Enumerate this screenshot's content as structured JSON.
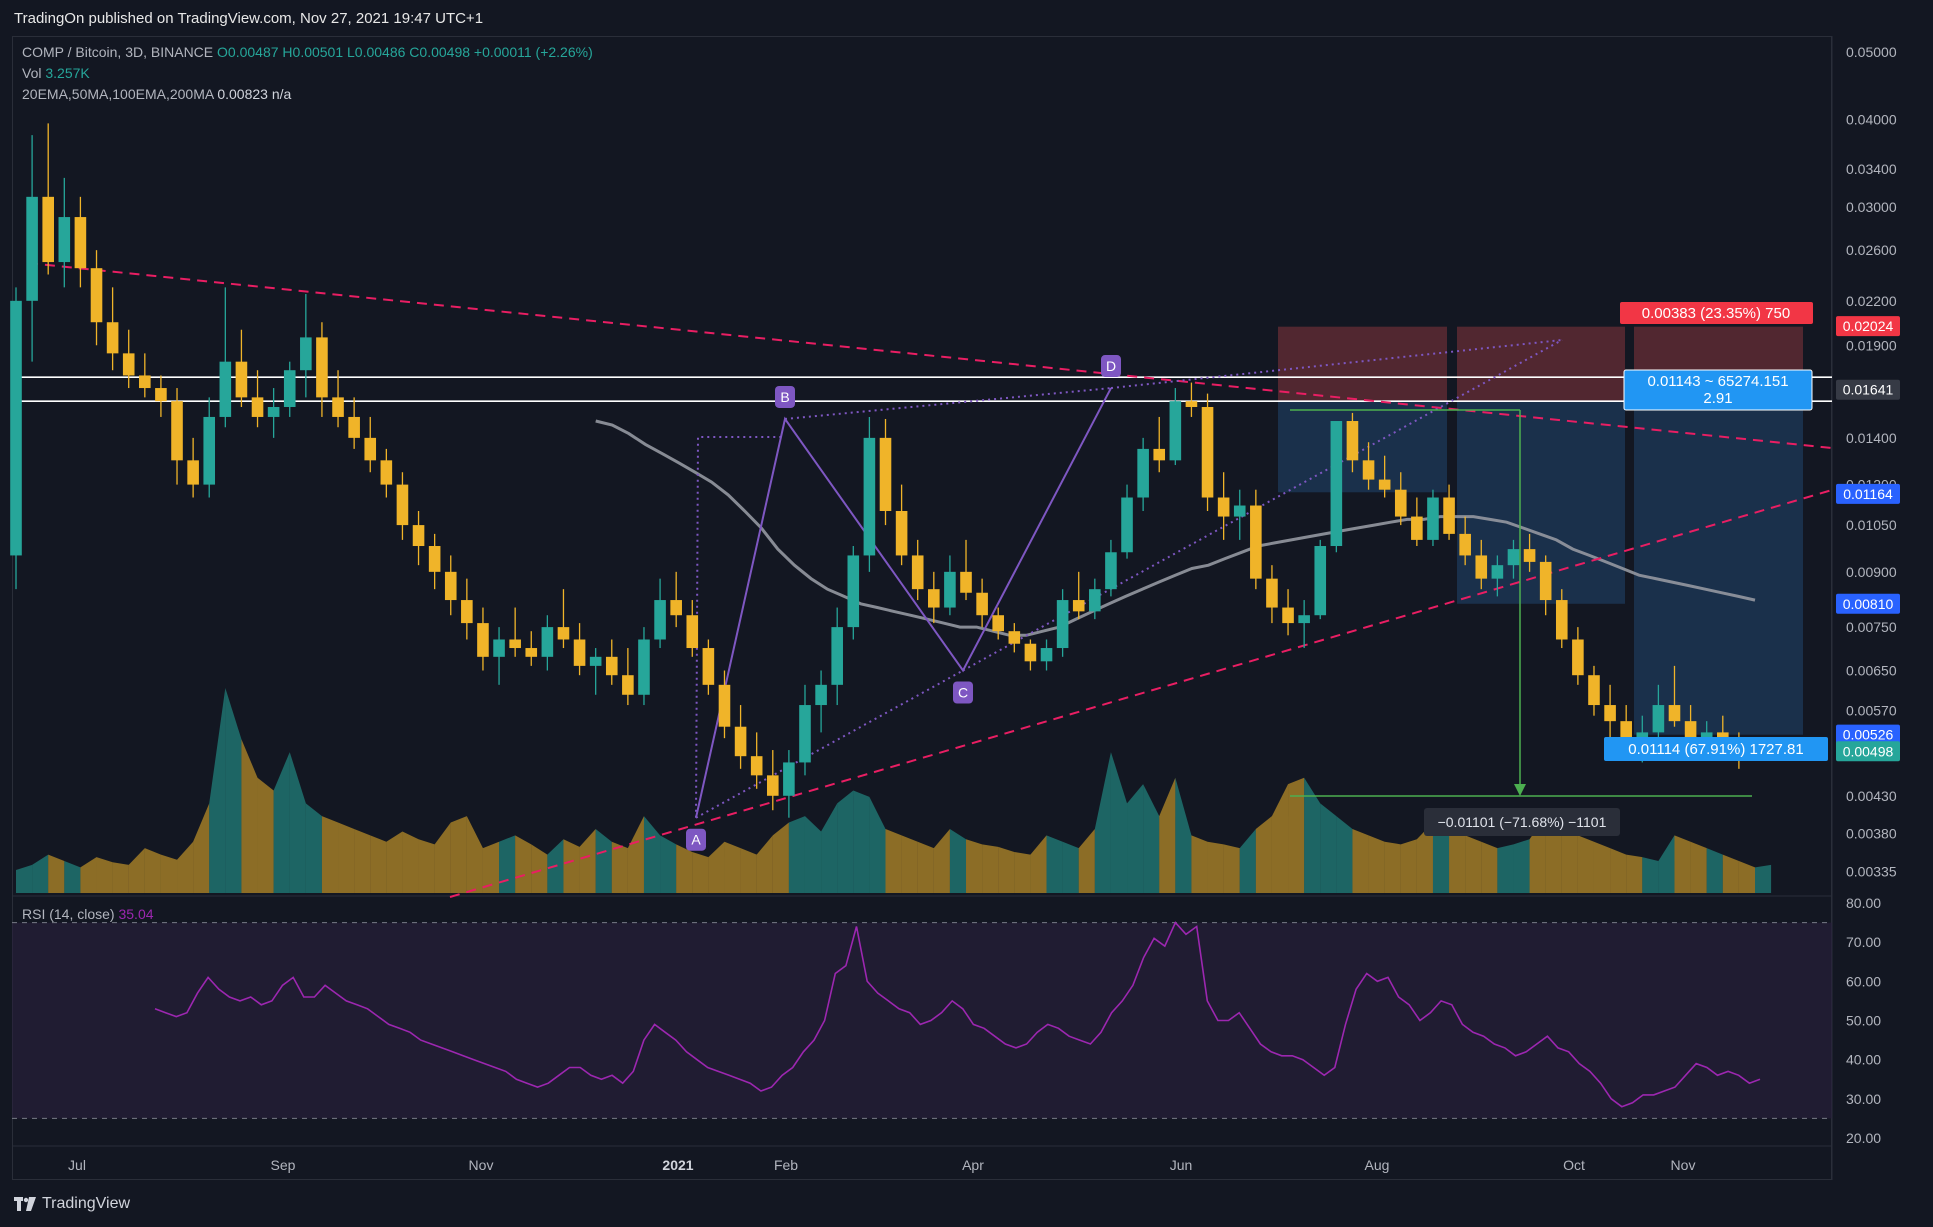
{
  "publisher": "TradingOn published on TradingView.com, Nov 27, 2021 19:47 UTC+1",
  "footer_brand": "TradingView",
  "legend": {
    "symbol": "COMP / Bitcoin, 3D, BINANCE",
    "ohlc": "O0.00487 H0.00501 L0.00486 C0.00498 +0.00011 (+2.26%)",
    "vol_label": "Vol",
    "vol_value": "3.257K",
    "ma_label": "20EMA,50MA,100EMA,200MA",
    "ma_value": "0.00823  n/a",
    "rsi_label": "RSI (14, close)",
    "rsi_value": "35.04"
  },
  "colors": {
    "bg": "#131722",
    "up": "#26a69a",
    "down": "#f0b429",
    "trend": "#e91e63",
    "harmonic": "#7e57c2",
    "rsi": "#9c27b0",
    "ma": "#9598a1",
    "stop_zone": "#5d2a32",
    "target_zone": "#1e3a5a"
  },
  "chart_data": [
    {
      "type": "candlestick",
      "title": "",
      "yscale": "log",
      "ylim": [
        0.0031,
        0.052
      ],
      "y_ticks": [
        "0.05000",
        "0.04000",
        "0.03400",
        "0.03000",
        "0.02600",
        "0.02200",
        "0.01900",
        "0.01400",
        "0.01200",
        "0.01050",
        "0.00900",
        "0.00750",
        "0.00650",
        "0.00570",
        "0.00430",
        "0.00380",
        "0.00335"
      ],
      "x_ticks": [
        "Jul",
        "Sep",
        "Nov",
        "2021",
        "Feb",
        "Apr",
        "Jun",
        "Aug",
        "Oct",
        "Nov"
      ],
      "price_badges": [
        {
          "label": "0.02024",
          "value": 0.02024,
          "color": "#f23645"
        },
        {
          "label": "0.01641",
          "value": 0.01641,
          "color": "#363a45"
        },
        {
          "label": "0.01164",
          "value": 0.01164,
          "color": "#2962ff"
        },
        {
          "label": "0.00810",
          "value": 0.0081,
          "color": "#2962ff"
        },
        {
          "label": "0.00526",
          "value": 0.00526,
          "color": "#2962ff"
        },
        {
          "label": "0.00498",
          "value": 0.00498,
          "color": "#26a69a"
        }
      ],
      "horizontal_levels": [
        0.0171,
        0.0158
      ],
      "harmonic_points": [
        {
          "label": "A",
          "date": "2020-12-29",
          "value": 0.004
        },
        {
          "label": "B",
          "date": "2021-01-31",
          "value": 0.0149
        },
        {
          "label": "C",
          "date": "2021-03-29",
          "value": 0.0065
        },
        {
          "label": "D",
          "date": "2021-05-19",
          "value": 0.0165
        }
      ],
      "position_boxes": [
        {
          "stop_label": "0.00383 (23.35%) 750",
          "target_label": "0.01143 ~ 65274.151",
          "ratio": "2.91"
        }
      ],
      "measure_label": "−0.01101 (−71.68%) −1101",
      "last_label": "0.01114 (67.91%) 1727.81",
      "candles": [
        [
          0.0095,
          0.023,
          0.0085,
          0.022
        ],
        [
          0.022,
          0.038,
          0.018,
          0.031
        ],
        [
          0.031,
          0.0395,
          0.024,
          0.025
        ],
        [
          0.025,
          0.033,
          0.023,
          0.029
        ],
        [
          0.029,
          0.031,
          0.023,
          0.0245
        ],
        [
          0.0245,
          0.026,
          0.019,
          0.0205
        ],
        [
          0.0205,
          0.023,
          0.0175,
          0.0185
        ],
        [
          0.0185,
          0.02,
          0.0165,
          0.0172
        ],
        [
          0.0172,
          0.0185,
          0.016,
          0.0165
        ],
        [
          0.0165,
          0.0172,
          0.015,
          0.0158
        ],
        [
          0.0158,
          0.0165,
          0.012,
          0.013
        ],
        [
          0.013,
          0.014,
          0.0115,
          0.012
        ],
        [
          0.012,
          0.016,
          0.0115,
          0.015
        ],
        [
          0.015,
          0.023,
          0.0145,
          0.018
        ],
        [
          0.018,
          0.02,
          0.0155,
          0.016
        ],
        [
          0.016,
          0.0175,
          0.0145,
          0.015
        ],
        [
          0.015,
          0.0165,
          0.014,
          0.0155
        ],
        [
          0.0155,
          0.018,
          0.015,
          0.0175
        ],
        [
          0.0175,
          0.0225,
          0.016,
          0.0195
        ],
        [
          0.0195,
          0.0205,
          0.015,
          0.016
        ],
        [
          0.016,
          0.0175,
          0.0145,
          0.015
        ],
        [
          0.015,
          0.016,
          0.0135,
          0.014
        ],
        [
          0.014,
          0.015,
          0.0125,
          0.013
        ],
        [
          0.013,
          0.0135,
          0.0115,
          0.012
        ],
        [
          0.012,
          0.0125,
          0.01,
          0.0105
        ],
        [
          0.0105,
          0.011,
          0.0092,
          0.0098
        ],
        [
          0.0098,
          0.0102,
          0.0085,
          0.009
        ],
        [
          0.009,
          0.0095,
          0.0078,
          0.0082
        ],
        [
          0.0082,
          0.0088,
          0.0072,
          0.0076
        ],
        [
          0.0076,
          0.008,
          0.0065,
          0.0068
        ],
        [
          0.0068,
          0.0075,
          0.0062,
          0.0072
        ],
        [
          0.0072,
          0.008,
          0.0068,
          0.007
        ],
        [
          0.007,
          0.0074,
          0.0066,
          0.0068
        ],
        [
          0.0068,
          0.0078,
          0.0065,
          0.0075
        ],
        [
          0.0075,
          0.0085,
          0.007,
          0.0072
        ],
        [
          0.0072,
          0.0076,
          0.0064,
          0.0066
        ],
        [
          0.0066,
          0.007,
          0.006,
          0.0068
        ],
        [
          0.0068,
          0.0072,
          0.0062,
          0.0064
        ],
        [
          0.0064,
          0.007,
          0.0058,
          0.006
        ],
        [
          0.006,
          0.0075,
          0.0058,
          0.0072
        ],
        [
          0.0072,
          0.0088,
          0.007,
          0.0082
        ],
        [
          0.0082,
          0.009,
          0.0075,
          0.0078
        ],
        [
          0.0078,
          0.0082,
          0.0068,
          0.007
        ],
        [
          0.007,
          0.0072,
          0.006,
          0.0062
        ],
        [
          0.0062,
          0.0065,
          0.0052,
          0.0054
        ],
        [
          0.0054,
          0.0058,
          0.0047,
          0.0049
        ],
        [
          0.0049,
          0.0053,
          0.0044,
          0.0046
        ],
        [
          0.0046,
          0.005,
          0.0041,
          0.0043
        ],
        [
          0.0043,
          0.005,
          0.004,
          0.0048
        ],
        [
          0.0048,
          0.0062,
          0.0046,
          0.0058
        ],
        [
          0.0058,
          0.0065,
          0.0053,
          0.0062
        ],
        [
          0.0062,
          0.008,
          0.0058,
          0.0075
        ],
        [
          0.0075,
          0.0098,
          0.0072,
          0.0095
        ],
        [
          0.0095,
          0.015,
          0.009,
          0.014
        ],
        [
          0.014,
          0.0149,
          0.0105,
          0.011
        ],
        [
          0.011,
          0.012,
          0.0092,
          0.0095
        ],
        [
          0.0095,
          0.01,
          0.0082,
          0.0085
        ],
        [
          0.0085,
          0.009,
          0.0076,
          0.008
        ],
        [
          0.008,
          0.0095,
          0.0078,
          0.009
        ],
        [
          0.009,
          0.01,
          0.0082,
          0.0084
        ],
        [
          0.0084,
          0.0088,
          0.0075,
          0.0078
        ],
        [
          0.0078,
          0.008,
          0.0072,
          0.0074
        ],
        [
          0.0074,
          0.0076,
          0.0069,
          0.0071
        ],
        [
          0.0071,
          0.0072,
          0.0065,
          0.0067
        ],
        [
          0.0067,
          0.0072,
          0.0065,
          0.007
        ],
        [
          0.007,
          0.0085,
          0.0068,
          0.0082
        ],
        [
          0.0082,
          0.009,
          0.0077,
          0.0079
        ],
        [
          0.0079,
          0.0088,
          0.0077,
          0.0085
        ],
        [
          0.0085,
          0.01,
          0.0083,
          0.0096
        ],
        [
          0.0096,
          0.012,
          0.0094,
          0.0115
        ],
        [
          0.0115,
          0.014,
          0.011,
          0.0135
        ],
        [
          0.0135,
          0.015,
          0.0125,
          0.013
        ],
        [
          0.013,
          0.0165,
          0.0128,
          0.0158
        ],
        [
          0.0158,
          0.0168,
          0.015,
          0.0155
        ],
        [
          0.0155,
          0.0162,
          0.011,
          0.0115
        ],
        [
          0.0115,
          0.0125,
          0.01,
          0.0108
        ],
        [
          0.0108,
          0.0118,
          0.01,
          0.0112
        ],
        [
          0.0112,
          0.0118,
          0.0085,
          0.0088
        ],
        [
          0.0088,
          0.0092,
          0.0076,
          0.008
        ],
        [
          0.008,
          0.0085,
          0.0073,
          0.0076
        ],
        [
          0.0076,
          0.0082,
          0.007,
          0.0078
        ],
        [
          0.0078,
          0.01,
          0.0077,
          0.0098
        ],
        [
          0.0098,
          0.014,
          0.0096,
          0.0148
        ],
        [
          0.0148,
          0.0152,
          0.0125,
          0.013
        ],
        [
          0.013,
          0.0138,
          0.0118,
          0.0122
        ],
        [
          0.0122,
          0.0132,
          0.0115,
          0.0118
        ],
        [
          0.0118,
          0.0125,
          0.0105,
          0.0108
        ],
        [
          0.0108,
          0.0115,
          0.0098,
          0.01
        ],
        [
          0.01,
          0.0118,
          0.0098,
          0.0115
        ],
        [
          0.0115,
          0.012,
          0.01,
          0.0102
        ],
        [
          0.0102,
          0.0108,
          0.0092,
          0.0095
        ],
        [
          0.0095,
          0.01,
          0.0085,
          0.0088
        ],
        [
          0.0088,
          0.0095,
          0.0083,
          0.0092
        ],
        [
          0.0092,
          0.01,
          0.0088,
          0.0097
        ],
        [
          0.0097,
          0.0102,
          0.009,
          0.0093
        ],
        [
          0.0093,
          0.0095,
          0.0078,
          0.0082
        ],
        [
          0.0082,
          0.0085,
          0.007,
          0.0072
        ],
        [
          0.0072,
          0.0075,
          0.0062,
          0.0064
        ],
        [
          0.0064,
          0.0066,
          0.0056,
          0.0058
        ],
        [
          0.0058,
          0.0062,
          0.0052,
          0.0055
        ],
        [
          0.0055,
          0.0058,
          0.005,
          0.0052
        ],
        [
          0.0052,
          0.0056,
          0.0048,
          0.0053
        ],
        [
          0.0053,
          0.0062,
          0.0051,
          0.0058
        ],
        [
          0.0058,
          0.0066,
          0.0054,
          0.0055
        ],
        [
          0.0055,
          0.0058,
          0.005,
          0.0052
        ],
        [
          0.0052,
          0.0055,
          0.0049,
          0.0053
        ],
        [
          0.0053,
          0.0056,
          0.005,
          0.0051
        ],
        [
          0.0051,
          0.0053,
          0.0047,
          0.0049
        ],
        [
          0.00487,
          0.00501,
          0.00486,
          0.00498
        ]
      ],
      "volume": [
        18,
        22,
        30,
        25,
        20,
        28,
        24,
        22,
        35,
        30,
        26,
        40,
        70,
        160,
        120,
        90,
        80,
        110,
        70,
        60,
        55,
        50,
        45,
        40,
        48,
        42,
        38,
        55,
        60,
        35,
        40,
        45,
        38,
        30,
        42,
        36,
        50,
        40,
        35,
        60,
        45,
        38,
        32,
        28,
        40,
        35,
        30,
        45,
        55,
        60,
        48,
        70,
        80,
        75,
        50,
        45,
        40,
        35,
        50,
        42,
        38,
        36,
        32,
        30,
        45,
        40,
        35,
        50,
        110,
        70,
        85,
        60,
        90,
        45,
        40,
        38,
        35,
        50,
        60,
        85,
        90,
        70,
        60,
        50,
        45,
        40,
        38,
        42,
        55,
        50,
        45,
        40,
        35,
        38,
        42,
        60,
        55,
        45,
        40,
        35,
        30,
        28,
        25,
        45,
        40,
        35,
        30,
        25,
        20,
        22
      ],
      "moving_average": {
        "name": "100EMA",
        "values": [
          0.0148,
          0.0146,
          0.0142,
          0.0137,
          0.0133,
          0.0129,
          0.0125,
          0.0121,
          0.0116,
          0.011,
          0.0104,
          0.0097,
          0.0092,
          0.0088,
          0.0085,
          0.0083,
          0.0081,
          0.008,
          0.0079,
          0.0078,
          0.0077,
          0.0076,
          0.0075,
          0.0075,
          0.0074,
          0.0073,
          0.0073,
          0.0074,
          0.0075,
          0.0077,
          0.0079,
          0.0081,
          0.0083,
          0.0085,
          0.0087,
          0.0089,
          0.0091,
          0.0092,
          0.0094,
          0.0096,
          0.0098,
          0.0099,
          0.01,
          0.0101,
          0.0102,
          0.0103,
          0.0104,
          0.0105,
          0.0106,
          0.0107,
          0.0107,
          0.0108,
          0.0108,
          0.0108,
          0.0107,
          0.0106,
          0.0104,
          0.0102,
          0.01,
          0.0097,
          0.0095,
          0.0093,
          0.0091,
          0.0089,
          0.0088,
          0.0087,
          0.0086,
          0.0085,
          0.0084,
          0.0083,
          0.0082
        ]
      },
      "rsi_series": {
        "name": "RSI (14, close)",
        "ylim": [
          20,
          80
        ],
        "y_ticks": [
          "80.00",
          "70.00",
          "60.00",
          "50.00",
          "40.00",
          "30.00",
          "20.00"
        ],
        "values": [
          53,
          52,
          51,
          52,
          57,
          61,
          58,
          56,
          55,
          56,
          54,
          55,
          59,
          61,
          56,
          56,
          59,
          57,
          55,
          54,
          53,
          51,
          49,
          48,
          47,
          45,
          44,
          43,
          42,
          41,
          40,
          39,
          38,
          37,
          35,
          34,
          33,
          34,
          36,
          38,
          38,
          36,
          35,
          36,
          34,
          37,
          45,
          49,
          47,
          45,
          42,
          40,
          38,
          37,
          36,
          35,
          34,
          32,
          33,
          36,
          38,
          42,
          45,
          50,
          62,
          64,
          74,
          60,
          57,
          55,
          53,
          52,
          49,
          50,
          52,
          55,
          53,
          49,
          48,
          46,
          44,
          43,
          44,
          47,
          49,
          48,
          46,
          45,
          44,
          47,
          52,
          55,
          59,
          66,
          71,
          69,
          75,
          72,
          74,
          55,
          50,
          50,
          52,
          48,
          44,
          42,
          41,
          41,
          40,
          38,
          36,
          38,
          49,
          58,
          62,
          60,
          61,
          56,
          54,
          50,
          52,
          55,
          54,
          49,
          47,
          46,
          44,
          43,
          41,
          42,
          44,
          46,
          43,
          42,
          39,
          37,
          34,
          30,
          28,
          29,
          31,
          31,
          32,
          33,
          36,
          39,
          38,
          36,
          37,
          36,
          34,
          35
        ]
      }
    }
  ]
}
